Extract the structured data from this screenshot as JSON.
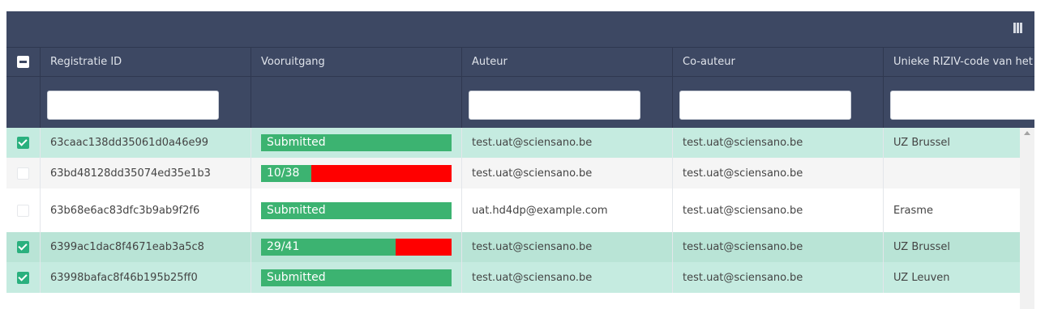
{
  "columns": [
    {
      "label": ""
    },
    {
      "label": "Registratie ID"
    },
    {
      "label": "Vooruitgang"
    },
    {
      "label": "Auteur"
    },
    {
      "label": "Co-auteur"
    },
    {
      "label": "Unieke RIZIV-code van het"
    }
  ],
  "filters": {
    "registratie_id": "",
    "auteur": "",
    "co_auteur": "",
    "riziv": ""
  },
  "rows": [
    {
      "selected": true,
      "id": "63caac138dd35061d0a46e99",
      "progress_label": "Submitted",
      "progress_fraction": 1.0,
      "author": "test.uat@sciensano.be",
      "coauthor": "test.uat@sciensano.be",
      "riziv": "UZ Brussel"
    },
    {
      "selected": false,
      "id": "63bd48128dd35074ed35e1b3",
      "progress_label": "10/38",
      "progress_fraction": 0.263,
      "author": "test.uat@sciensano.be",
      "coauthor": "test.uat@sciensano.be",
      "riziv": ""
    },
    {
      "selected": false,
      "id": "63b68e6ac83dfc3b9ab9f2f6",
      "progress_label": "Submitted",
      "progress_fraction": 1.0,
      "author": "uat.hd4dp@example.com",
      "coauthor": "test.uat@sciensano.be",
      "riziv": "Erasme"
    },
    {
      "selected": true,
      "id": "6399ac1dac8f4671eab3a5c8",
      "progress_label": "29/41",
      "progress_fraction": 0.707,
      "author": "test.uat@sciensano.be",
      "coauthor": "test.uat@sciensano.be",
      "riziv": "UZ Brussel"
    },
    {
      "selected": true,
      "id": "63998bafac8f46b195b25ff0",
      "progress_label": "Submitted",
      "progress_fraction": 1.0,
      "author": "test.uat@sciensano.be",
      "coauthor": "test.uat@sciensano.be",
      "riziv": "UZ Leuven"
    }
  ],
  "colors": {
    "header_bg": "#3d4863",
    "selected_row": "#c5ebe0",
    "progress_done": "#3cb371",
    "progress_remaining": "#ff0000",
    "checkbox_on": "#2ab07e"
  },
  "icons": {
    "columns": "columns-icon",
    "scroll_up": "scroll-up-arrow-icon"
  }
}
